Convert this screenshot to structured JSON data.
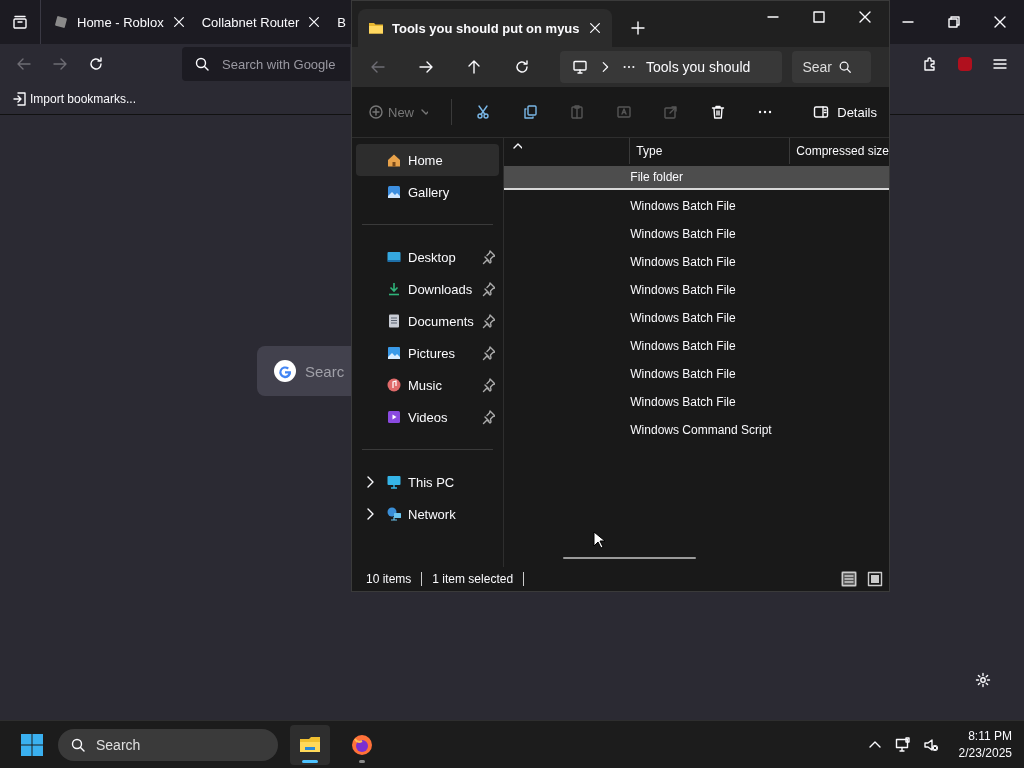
{
  "browser": {
    "tabs": [
      {
        "label": "Home - Roblox",
        "favicon": true,
        "closable": true
      },
      {
        "label": "Collabnet Router",
        "favicon": false,
        "closable": true
      },
      {
        "label": "B",
        "favicon": false,
        "closable": false
      }
    ],
    "address": {
      "placeholder": "Search with Google"
    },
    "bookmarks": [
      {
        "label": "Import bookmarks..."
      }
    ],
    "google_search": {
      "placeholder": "Searc"
    }
  },
  "explorer": {
    "tabs": [
      {
        "title": "Tools you should put on myus",
        "selected": true
      }
    ],
    "address": {
      "crumb": "Tools you should"
    },
    "search": {
      "placeholder": "Sear"
    },
    "command_bar": {
      "new_label": "New",
      "details_label": "Details",
      "tools": [
        {
          "kind": "cut",
          "disabled": false
        },
        {
          "kind": "copy",
          "disabled": false
        },
        {
          "kind": "paste",
          "disabled": true
        },
        {
          "kind": "rename",
          "disabled": true
        },
        {
          "kind": "share",
          "disabled": true
        },
        {
          "kind": "delete",
          "disabled": false
        },
        {
          "kind": "more",
          "disabled": false
        }
      ]
    },
    "nav": [
      [
        {
          "label": "Home",
          "pinned": false,
          "selected": true,
          "expandable": false
        },
        {
          "label": "Gallery",
          "pinned": false,
          "selected": false,
          "expandable": false
        }
      ],
      [
        {
          "label": "Desktop",
          "pinned": true,
          "selected": false,
          "expandable": false
        },
        {
          "label": "Downloads",
          "pinned": true,
          "selected": false,
          "expandable": false
        },
        {
          "label": "Documents",
          "pinned": true,
          "selected": false,
          "expandable": false
        },
        {
          "label": "Pictures",
          "pinned": true,
          "selected": false,
          "expandable": false
        },
        {
          "label": "Music",
          "pinned": true,
          "selected": false,
          "expandable": false
        },
        {
          "label": "Videos",
          "pinned": true,
          "selected": false,
          "expandable": false
        }
      ],
      [
        {
          "label": "This PC",
          "pinned": false,
          "selected": false,
          "expandable": true
        },
        {
          "label": "Network",
          "pinned": false,
          "selected": false,
          "expandable": true
        }
      ]
    ],
    "columns": [
      {
        "label": "Type"
      },
      {
        "label": "Compressed size"
      }
    ],
    "rows": [
      {
        "type": "File folder",
        "selected": true
      },
      {
        "type": "Windows Batch File",
        "selected": false
      },
      {
        "type": "Windows Batch File",
        "selected": false
      },
      {
        "type": "Windows Batch File",
        "selected": false
      },
      {
        "type": "Windows Batch File",
        "selected": false
      },
      {
        "type": "Windows Batch File",
        "selected": false
      },
      {
        "type": "Windows Batch File",
        "selected": false
      },
      {
        "type": "Windows Batch File",
        "selected": false
      },
      {
        "type": "Windows Batch File",
        "selected": false
      },
      {
        "type": "Windows Command Script",
        "selected": false
      }
    ],
    "status": {
      "count": "10 items",
      "selection": "1 item selected"
    },
    "views": [
      {
        "kind": "details",
        "selected": true
      },
      {
        "kind": "tiles",
        "selected": false
      }
    ]
  },
  "taskbar": {
    "search": {
      "placeholder": "Search"
    },
    "apps": [
      {
        "kind": "explorer",
        "active": true
      },
      {
        "kind": "firefox",
        "active": false
      }
    ],
    "time": "8:11 PM",
    "date": "2/23/2025"
  }
}
